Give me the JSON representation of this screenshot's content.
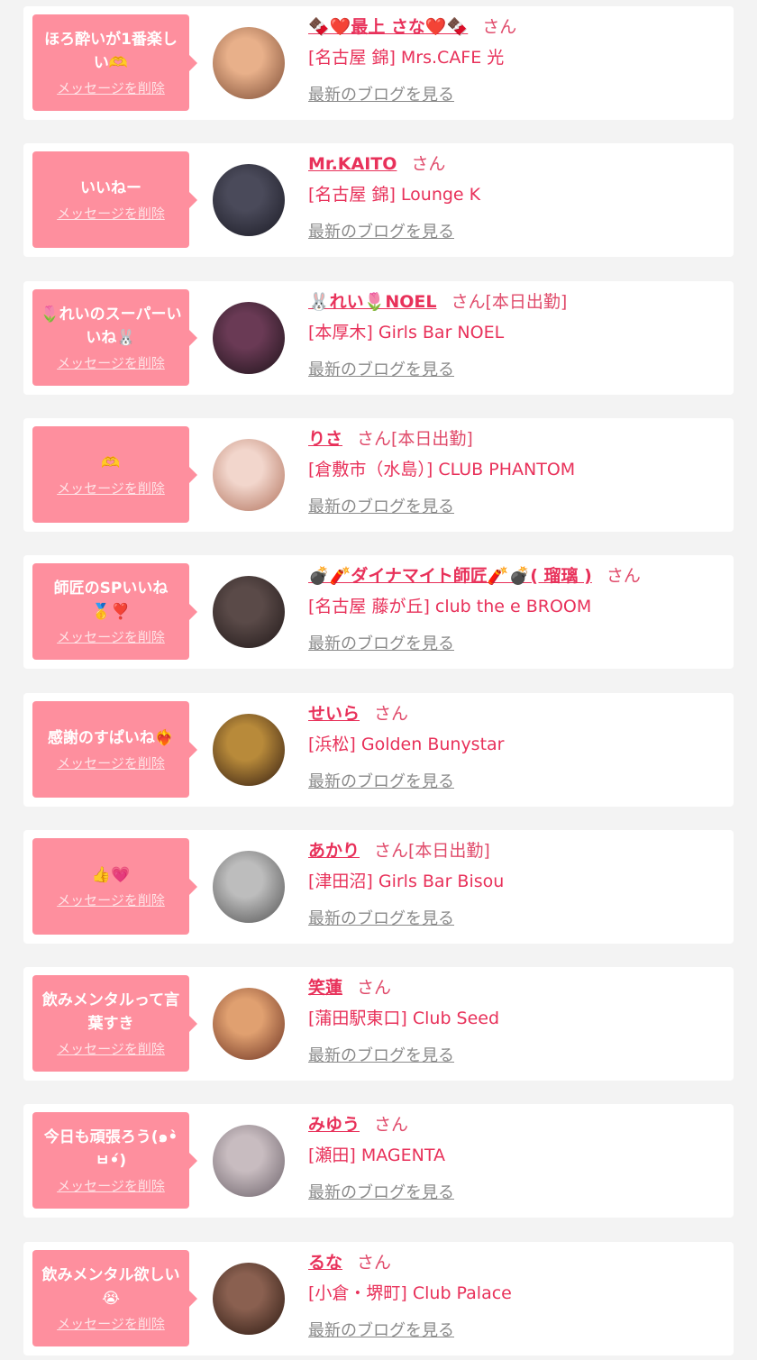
{
  "delete_label": "メッセージを削除",
  "san_label": "さん",
  "blog_label": "最新のブログを見る",
  "colors": {
    "bubble": "#fe8f9e",
    "accent": "#e8315a",
    "muted": "#8a8a8a",
    "background": "#f3f3f3"
  },
  "messages": [
    {
      "message": "ほろ酔いが1番楽しい🫶",
      "name": "🍫❤️最上 さな❤️🍫",
      "san": "さん",
      "store": "[名古屋 錦] Mrs.CAFE 光"
    },
    {
      "message": "いいねー",
      "name": "Mr.KAITO",
      "san": "さん",
      "store": "[名古屋 錦] Lounge K"
    },
    {
      "message": "🌷れいのスーパーいいね🐰",
      "name": "🐰れい🌷NOEL",
      "san": "さん[本日出勤]",
      "store": "[本厚木] Girls Bar NOEL"
    },
    {
      "message": "🫶",
      "name": "りさ",
      "san": "さん[本日出勤]",
      "store": "[倉敷市（水島）] CLUB PHANTOM"
    },
    {
      "message": "師匠のSPいいね🥇❣️",
      "name": "💣🧨ダイナマイト師匠🧨💣( 瑠璃 )",
      "san": "さん",
      "store": "[名古屋 藤が丘] club the e BROOM"
    },
    {
      "message": "感謝のすぱいね❤️‍🔥",
      "name": "せいら",
      "san": "さん",
      "store": "[浜松] Golden Bunystar"
    },
    {
      "message": "👍💗",
      "name": "あかり",
      "san": "さん[本日出勤]",
      "store": "[津田沼] Girls Bar Bisou"
    },
    {
      "message": "飲みメンタルって言葉すき",
      "name": "笑蓮",
      "san": "さん",
      "store": "[蒲田駅東口] Club Seed"
    },
    {
      "message": "今日も頑張ろう(๑•̀ㅂ•́)",
      "name": "みゆう",
      "san": "さん",
      "store": "[瀬田] MAGENTA"
    },
    {
      "message": "飲みメンタル欲しい😭",
      "name": "るな",
      "san": "さん",
      "store": "[小倉・堺町] Club Palace"
    }
  ],
  "avatars": [
    {
      "name": "avatar-photo",
      "c1": "#e8b08a",
      "c2": "#7a4a33"
    },
    {
      "name": "avatar-photo",
      "c1": "#4a4a5a",
      "c2": "#1a1a24"
    },
    {
      "name": "avatar-photo",
      "c1": "#6a3a55",
      "c2": "#1c1218"
    },
    {
      "name": "avatar-photo",
      "c1": "#f2d6cc",
      "c2": "#b0705a"
    },
    {
      "name": "avatar-photo",
      "c1": "#5a4a48",
      "c2": "#201818"
    },
    {
      "name": "avatar-photo",
      "c1": "#b88a3a",
      "c2": "#301a10"
    },
    {
      "name": "avatar-photo",
      "c1": "#bdbdbd",
      "c2": "#505050"
    },
    {
      "name": "avatar-photo",
      "c1": "#e0a070",
      "c2": "#6a3020"
    },
    {
      "name": "avatar-photo",
      "c1": "#c8bcc0",
      "c2": "#6a6068"
    },
    {
      "name": "avatar-photo",
      "c1": "#8a6050",
      "c2": "#2a1810"
    }
  ]
}
